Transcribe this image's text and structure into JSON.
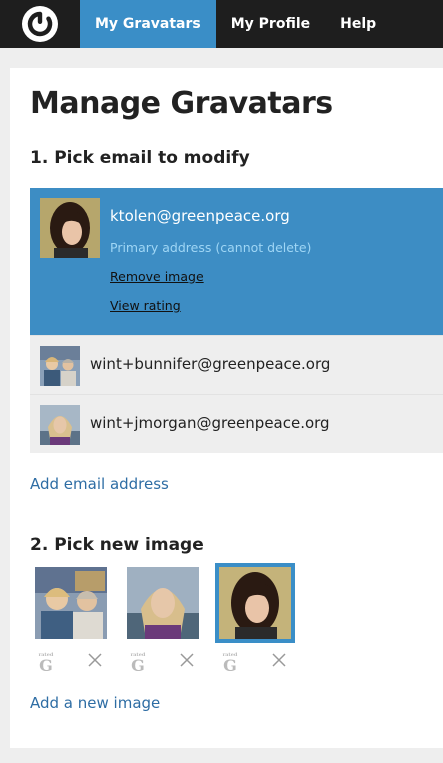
{
  "nav": {
    "items": [
      {
        "label": "My Gravatars"
      },
      {
        "label": "My Profile"
      },
      {
        "label": "Help"
      }
    ]
  },
  "page": {
    "title": "Manage Gravatars",
    "step1_title": "1. Pick email to modify",
    "step2_title": "2. Pick new image"
  },
  "emails": {
    "selected": {
      "address": "ktolen@greenpeace.org",
      "primary_note": "Primary address (cannot delete)",
      "remove_image": "Remove image",
      "view_rating": "View rating"
    },
    "others": [
      {
        "address": "wint+bunnifer@greenpeace.org"
      },
      {
        "address": "wint+jmorgan@greenpeace.org"
      }
    ],
    "add_email": "Add email address"
  },
  "images": {
    "rating_small": "rated",
    "rating_big": "G",
    "add_image": "Add a new image"
  },
  "colors": {
    "nav_bg": "#1e1e1e",
    "accent": "#3a8ec7",
    "selected_row": "#3d8dc4",
    "link": "#2e6da4"
  }
}
